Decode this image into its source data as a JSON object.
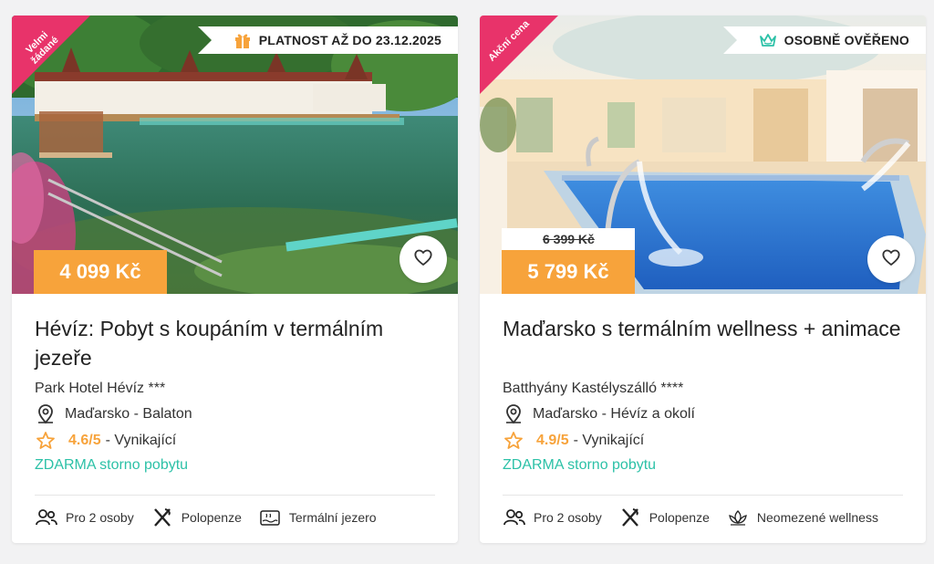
{
  "colors": {
    "accent_orange": "#f7a33b",
    "ribbon_pink": "#e8336a",
    "cancel_green": "#2cc1a7",
    "star_orange": "#f7a33b"
  },
  "cards": [
    {
      "ribbon": "Velmi žádané",
      "banner": {
        "icon": "gift-icon",
        "text": "PLATNOST AŽ DO 23.12.2025"
      },
      "price": "4 099 Kč",
      "title": "Hévíz: Pobyt s koupáním v termálním jezeře",
      "hotel": "Park Hotel Hévíz ***",
      "location": "Maďarsko - Balaton",
      "rating_score": "4.6/5",
      "rating_label": "- Vynikající",
      "cancellation": "ZDARMA storno pobytu",
      "features": [
        {
          "icon": "people-icon",
          "label": "Pro 2 osoby"
        },
        {
          "icon": "cutlery-icon",
          "label": "Polopenze"
        },
        {
          "icon": "thermal-lake-icon",
          "label": "Termální jezero"
        }
      ]
    },
    {
      "ribbon": "Akční cena",
      "banner": {
        "icon": "crown-icon",
        "text": "OSOBNĚ OVĚŘENO"
      },
      "price_old": "6 399 Kč",
      "price": "5 799 Kč",
      "title": "Maďarsko s termálním wellness + animace",
      "hotel": "Batthyány Kastélyszálló ****",
      "location": "Maďarsko - Hévíz a okolí",
      "rating_score": "4.9/5",
      "rating_label": "- Vynikající",
      "cancellation": "ZDARMA storno pobytu",
      "features": [
        {
          "icon": "people-icon",
          "label": "Pro 2 osoby"
        },
        {
          "icon": "cutlery-icon",
          "label": "Polopenze"
        },
        {
          "icon": "lotus-icon",
          "label": "Neomezené wellness"
        }
      ]
    }
  ]
}
